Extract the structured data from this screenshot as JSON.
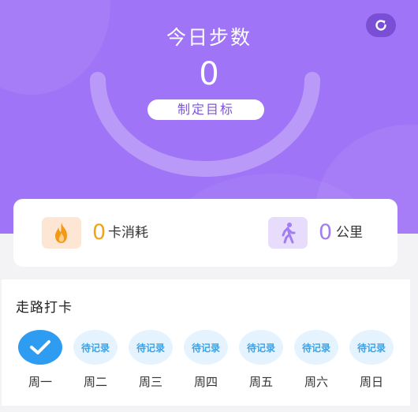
{
  "header": {
    "title": "今日步数",
    "steps": "0",
    "goal_button": "制定目标"
  },
  "stats": {
    "calories_value": "0",
    "calories_label": "卡消耗",
    "distance_value": "0",
    "distance_label": "公里"
  },
  "checkin": {
    "title": "走路打卡",
    "pending_label": "待记录",
    "days": [
      {
        "label": "周一",
        "status": "done"
      },
      {
        "label": "周二",
        "status": "pending"
      },
      {
        "label": "周三",
        "status": "pending"
      },
      {
        "label": "周四",
        "status": "pending"
      },
      {
        "label": "周五",
        "status": "pending"
      },
      {
        "label": "周六",
        "status": "pending"
      },
      {
        "label": "周日",
        "status": "pending"
      }
    ]
  },
  "icons": {
    "refresh": "refresh-icon",
    "calories": "fire-icon",
    "distance": "walking-icon",
    "done": "checkmark-icon"
  },
  "colors": {
    "header": "#a074f6",
    "accent_orange": "#f0a418",
    "accent_purple": "#a27cf2",
    "checkin_blue": "#2e9cf0"
  }
}
